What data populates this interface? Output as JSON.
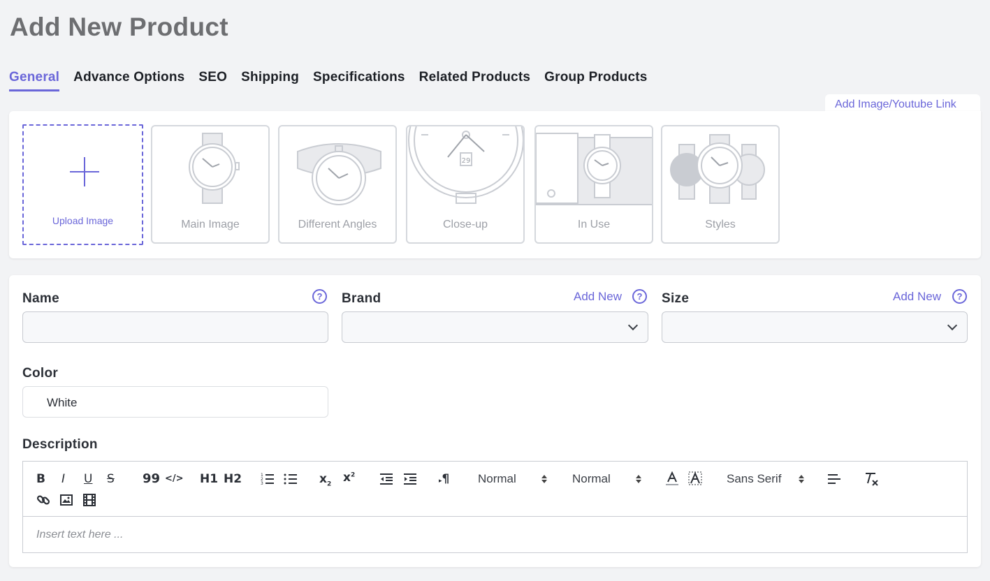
{
  "page": {
    "title": "Add New Product"
  },
  "tabs": [
    {
      "label": "General",
      "active": true
    },
    {
      "label": "Advance Options"
    },
    {
      "label": "SEO"
    },
    {
      "label": "Shipping"
    },
    {
      "label": "Specifications"
    },
    {
      "label": "Related Products"
    },
    {
      "label": "Group Products"
    }
  ],
  "images": {
    "add_link": "Add Image/Youtube Link",
    "upload_label": "Upload Image",
    "thumbs": [
      {
        "label": "Main Image"
      },
      {
        "label": "Different Angles"
      },
      {
        "label": "Close-up",
        "date": "29"
      },
      {
        "label": "In Use"
      },
      {
        "label": "Styles"
      }
    ]
  },
  "form": {
    "name": {
      "label": "Name",
      "value": ""
    },
    "brand": {
      "label": "Brand",
      "add_new": "Add New",
      "value": ""
    },
    "size": {
      "label": "Size",
      "add_new": "Add New",
      "value": ""
    },
    "color": {
      "label": "Color",
      "value": "White"
    },
    "description": {
      "label": "Description",
      "placeholder": "Insert text here ...",
      "toolbar": {
        "bold": "B",
        "italic": "I",
        "underline": "U",
        "strike": "S",
        "quote": "99",
        "code": "</>",
        "h1": "H1",
        "h2": "H2",
        "subscript": "x2",
        "superscript": "x2",
        "paragraph": "¶",
        "header_select": "Normal",
        "size_select": "Normal",
        "font_select": "Sans Serif"
      }
    }
  },
  "icons": {
    "help": "question-circle-icon",
    "chevron": "chevron-down-icon"
  },
  "colors": {
    "accent": "#6a66d9",
    "page_bg": "#f2f3f5",
    "card_bg": "#ffffff"
  }
}
